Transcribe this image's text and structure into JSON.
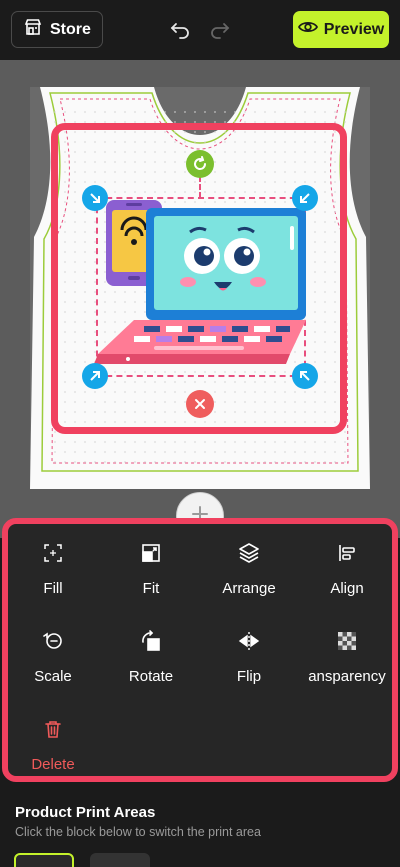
{
  "topbar": {
    "store_label": "Store",
    "preview_label": "Preview",
    "icons": [
      "store-icon",
      "undo-icon",
      "redo-icon",
      "eye-icon"
    ]
  },
  "canvas": {
    "handles": [
      "rotate-icon",
      "resize-icon",
      "delete-icon"
    ],
    "add_icon": "plus-icon"
  },
  "tools": [
    {
      "label": "Fill",
      "icon": "fill-icon"
    },
    {
      "label": "Fit",
      "icon": "fit-icon"
    },
    {
      "label": "Arrange",
      "icon": "layers-icon"
    },
    {
      "label": "Align",
      "icon": "align-icon"
    },
    {
      "label": "Scale",
      "icon": "scale-icon"
    },
    {
      "label": "Rotate",
      "icon": "rotate-icon"
    },
    {
      "label": "Flip",
      "icon": "flip-icon"
    },
    {
      "label": "ansparency",
      "icon": "transparency-icon"
    },
    {
      "label": "Delete",
      "icon": "trash-icon"
    }
  ],
  "print_areas": {
    "title": "Product Print Areas",
    "subtitle": "Click the block below to switch the print area"
  },
  "colors": {
    "accent": "#c4f22b",
    "highlight": "#f0415f",
    "handle": "#15a6e8",
    "delete": "#f05a5a"
  }
}
